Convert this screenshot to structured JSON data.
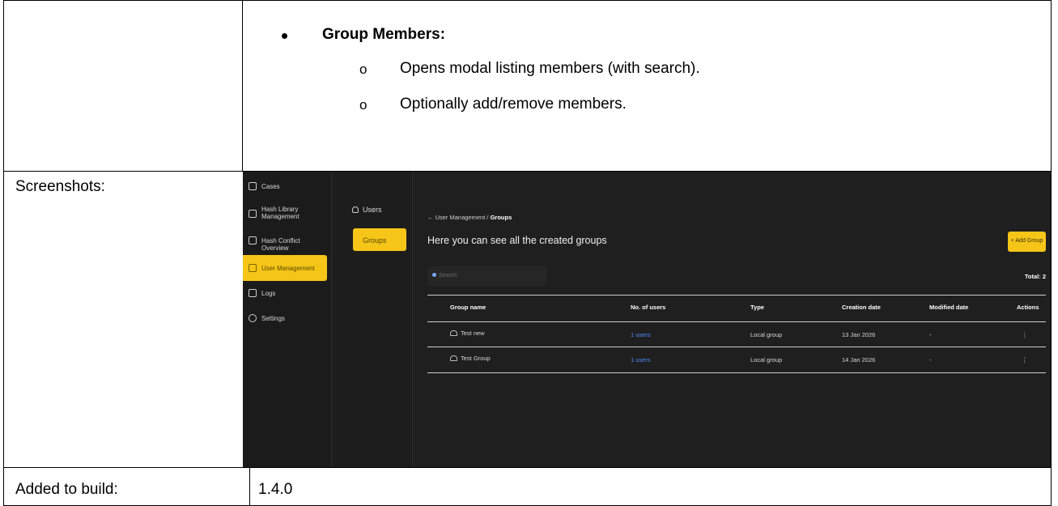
{
  "section": {
    "bullet_title": "Group Members:",
    "sub_items": [
      "Opens modal listing members (with search).",
      "Optionally add/remove members."
    ],
    "sub_marker": "o"
  },
  "rows": {
    "screenshots_label": "Screenshots:",
    "added_label": "Added to build:",
    "added_value": "1.4.0"
  },
  "app": {
    "accent": "#f5c518",
    "sidebar": [
      {
        "label": "Cases",
        "icon": "folder-icon"
      },
      {
        "label": "Hash Library\nManagement",
        "icon": "library-icon"
      },
      {
        "label": "Hash Conflict Overview",
        "icon": "conflict-icon"
      },
      {
        "label": "User Management",
        "icon": "user-icon",
        "active": true
      },
      {
        "label": "Logs",
        "icon": "file-icon"
      },
      {
        "label": "Settings",
        "icon": "gear-icon"
      }
    ],
    "subnav": {
      "users": "Users",
      "groups": "Groups"
    },
    "breadcrumb": {
      "parent": "User Management",
      "separator": "/",
      "current": "Groups"
    },
    "heading": "Here you can see all the created groups",
    "add_button": "+ Add Group",
    "search_placeholder": "Search",
    "total": "Total: 2",
    "table": {
      "headers": [
        "Group name",
        "No. of users",
        "Type",
        "Creation date",
        "Modified date",
        "Actions"
      ],
      "rows": [
        [
          "Test new",
          "1 users",
          "Local group",
          "13 Jan 2026",
          "-",
          "⋮"
        ],
        [
          "Test Group",
          "1 users",
          "Local group",
          "14 Jan 2026",
          "-",
          "⋮"
        ]
      ]
    }
  }
}
